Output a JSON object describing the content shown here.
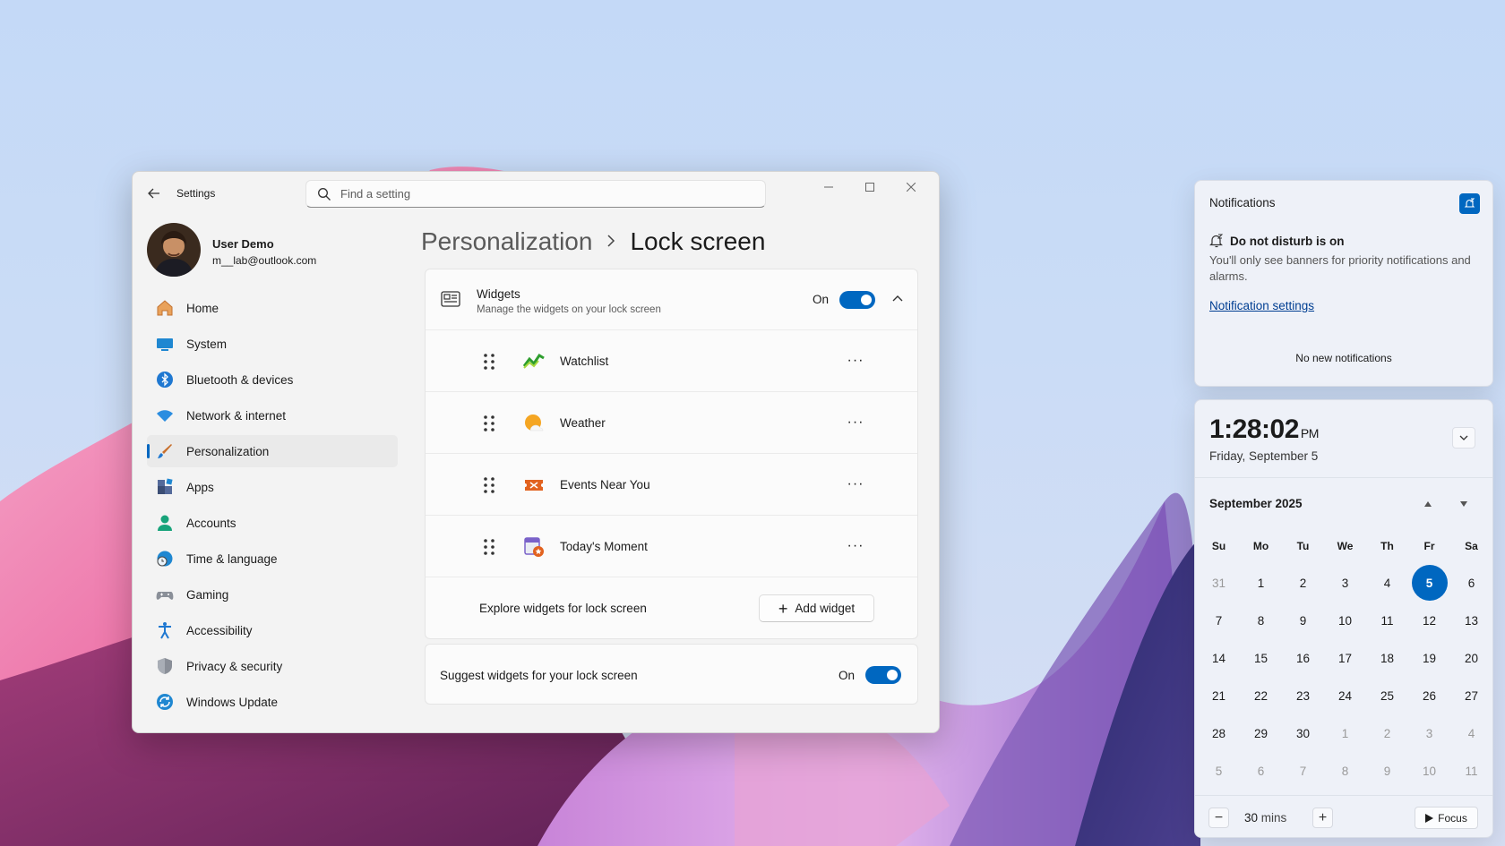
{
  "colors": {
    "accent": "#0067c0",
    "window_bg": "#f3f3f3",
    "card_bg": "#fbfbfb"
  },
  "settings": {
    "title": "Settings",
    "search_placeholder": "Find a setting",
    "user": {
      "name": "User Demo",
      "email": "m__lab@outlook.com"
    },
    "nav": [
      {
        "label": "Home",
        "icon": "home-icon"
      },
      {
        "label": "System",
        "icon": "system-icon"
      },
      {
        "label": "Bluetooth & devices",
        "icon": "bluetooth-icon"
      },
      {
        "label": "Network & internet",
        "icon": "wifi-icon"
      },
      {
        "label": "Personalization",
        "icon": "brush-icon",
        "active": true
      },
      {
        "label": "Apps",
        "icon": "apps-icon"
      },
      {
        "label": "Accounts",
        "icon": "accounts-icon"
      },
      {
        "label": "Time & language",
        "icon": "clock-globe-icon"
      },
      {
        "label": "Gaming",
        "icon": "gamepad-icon"
      },
      {
        "label": "Accessibility",
        "icon": "accessibility-icon"
      },
      {
        "label": "Privacy & security",
        "icon": "shield-icon"
      },
      {
        "label": "Windows Update",
        "icon": "update-icon"
      }
    ],
    "breadcrumb": {
      "parent": "Personalization",
      "current": "Lock screen"
    },
    "widgets": {
      "title": "Widgets",
      "subtitle": "Manage the widgets on your lock screen",
      "state": "On",
      "items": [
        {
          "name": "Watchlist",
          "icon": "watchlist-icon"
        },
        {
          "name": "Weather",
          "icon": "weather-icon"
        },
        {
          "name": "Events Near You",
          "icon": "ticket-icon"
        },
        {
          "name": "Today's Moment",
          "icon": "moment-icon"
        }
      ],
      "more_label": "···",
      "explore_label": "Explore widgets for lock screen",
      "add_label": "Add widget",
      "add_plus": "+"
    },
    "suggest": {
      "label": "Suggest widgets for your lock screen",
      "state": "On"
    }
  },
  "notifications": {
    "title": "Notifications",
    "dnd_heading": "Do not disturb is on",
    "dnd_desc": "You'll only see banners for priority notifications and alarms.",
    "settings_link": "Notification settings",
    "empty": "No new notifications"
  },
  "calendar": {
    "time": "1:28:02",
    "ampm": "PM",
    "date": "Friday, September 5",
    "month": "September 2025",
    "weekdays": [
      "Su",
      "Mo",
      "Tu",
      "We",
      "Th",
      "Fr",
      "Sa"
    ],
    "days": [
      {
        "d": "31",
        "o": true
      },
      {
        "d": "1"
      },
      {
        "d": "2"
      },
      {
        "d": "3"
      },
      {
        "d": "4"
      },
      {
        "d": "5",
        "today": true
      },
      {
        "d": "6"
      },
      {
        "d": "7"
      },
      {
        "d": "8"
      },
      {
        "d": "9"
      },
      {
        "d": "10"
      },
      {
        "d": "11"
      },
      {
        "d": "12"
      },
      {
        "d": "13"
      },
      {
        "d": "14"
      },
      {
        "d": "15"
      },
      {
        "d": "16"
      },
      {
        "d": "17"
      },
      {
        "d": "18"
      },
      {
        "d": "19"
      },
      {
        "d": "20"
      },
      {
        "d": "21"
      },
      {
        "d": "22"
      },
      {
        "d": "23"
      },
      {
        "d": "24"
      },
      {
        "d": "25"
      },
      {
        "d": "26"
      },
      {
        "d": "27"
      },
      {
        "d": "28"
      },
      {
        "d": "29"
      },
      {
        "d": "30"
      },
      {
        "d": "1",
        "o": true
      },
      {
        "d": "2",
        "o": true
      },
      {
        "d": "3",
        "o": true
      },
      {
        "d": "4",
        "o": true
      },
      {
        "d": "5",
        "o": true
      },
      {
        "d": "6",
        "o": true
      },
      {
        "d": "7",
        "o": true
      },
      {
        "d": "8",
        "o": true
      },
      {
        "d": "9",
        "o": true
      },
      {
        "d": "10",
        "o": true
      },
      {
        "d": "11",
        "o": true
      }
    ],
    "focus": {
      "minus": "−",
      "plus": "+",
      "value": "30",
      "unit": "mins",
      "button": "Focus"
    }
  }
}
